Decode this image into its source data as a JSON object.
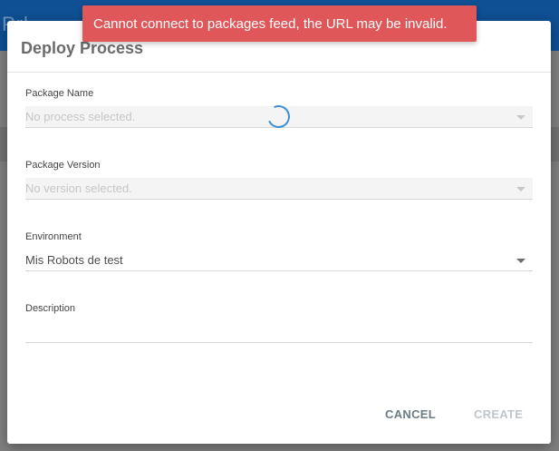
{
  "background": {
    "header_text": "Prl"
  },
  "toast": {
    "message": "Cannot connect to packages feed, the URL may be invalid."
  },
  "dialog": {
    "title": "Deploy Process",
    "fields": {
      "package_name": {
        "label": "Package Name",
        "value": "No process selected."
      },
      "package_version": {
        "label": "Package Version",
        "value": "No version selected."
      },
      "environment": {
        "label": "Environment",
        "value": "Mis Robots de test"
      },
      "description": {
        "label": "Description",
        "value": ""
      }
    },
    "buttons": {
      "cancel": "CANCEL",
      "create": "CREATE"
    }
  },
  "colors": {
    "toast_bg": "#e0575a",
    "header_bg": "#0f4f93",
    "spinner": "#3a8fd6"
  },
  "icons": {
    "loading": "spinner-icon",
    "dropdown": "chevron-down-icon"
  }
}
